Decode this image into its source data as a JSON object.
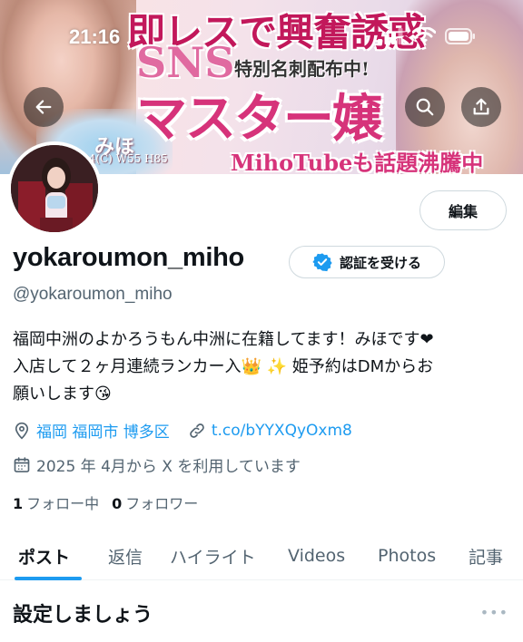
{
  "status_bar": {
    "time": "21:16"
  },
  "banner": {
    "line1": "即レスで興奮誘惑",
    "sns": "SNS",
    "special": "特別名刺配布中!",
    "master": "マスター嬢",
    "name": "みほ",
    "sizes": "84(C) W55 H85",
    "tube": "MihoTubeも話題沸騰中"
  },
  "header_buttons": {
    "back_icon": "arrow-left-icon",
    "search_icon": "search-icon",
    "share_icon": "share-icon"
  },
  "profile": {
    "edit_label": "編集",
    "display_name": "yokaroumon_miho",
    "verify_label": "認証を受ける",
    "handle": "@yokaroumon_miho",
    "bio_line1": "福岡中洲のよかろうもん中洲に在籍してます！みほです❤",
    "bio_line2": "入店して２ヶ月連続ランカー入👑 ✨ 姫予約はDMからお",
    "bio_line3": "願いします😘",
    "location": "福岡 福岡市 博多区",
    "link": "t.co/bYYXQyOxm8",
    "joined": "2025 年 4月から X を利用しています",
    "following_count": "1",
    "following_label": "フォロー中",
    "followers_count": "0",
    "followers_label": "フォロワー"
  },
  "tabs": [
    "ポスト",
    "返信",
    "ハイライト",
    "Videos",
    "Photos",
    "記事"
  ],
  "setup": {
    "title": "設定しましょう",
    "more": "•••"
  },
  "colors": {
    "accent": "#1d9bf0",
    "text": "#0f1419",
    "muted": "#536471",
    "verified": "#1d9bf0"
  }
}
